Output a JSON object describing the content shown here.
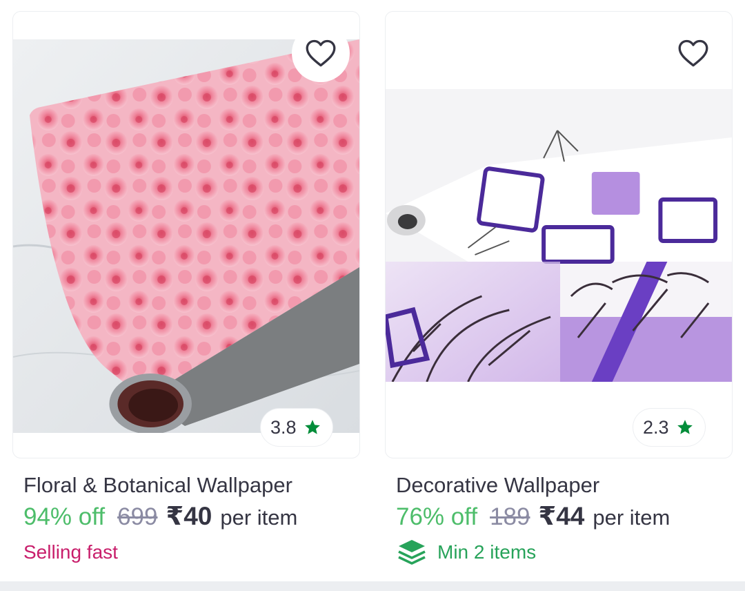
{
  "products": [
    {
      "title": "Floral & Botanical Wallpaper",
      "discount": "94% off",
      "mrp": "699",
      "price": "₹40",
      "unit": "per item",
      "rating": "3.8",
      "tag": "Selling fast",
      "image": "pink-roses-wallpaper-roll",
      "wishlist_icon": "heart-outline-icon",
      "rating_icon": "star-icon"
    },
    {
      "title": "Decorative Wallpaper",
      "discount": "76% off",
      "mrp": "189",
      "price": "₹44",
      "unit": "per item",
      "rating": "2.3",
      "tag": "Min 2 items",
      "tag_icon": "layers-icon",
      "image": "purple-squares-tree-wallpaper-roll",
      "wishlist_icon": "heart-outline-icon",
      "rating_icon": "star-icon"
    }
  ],
  "colors": {
    "discount": "#4dbd6a",
    "selling_fast": "#c81e6b",
    "min_items": "#27a35a",
    "star": "#038d3a",
    "text": "#353543",
    "strike": "#8b8ba3"
  }
}
